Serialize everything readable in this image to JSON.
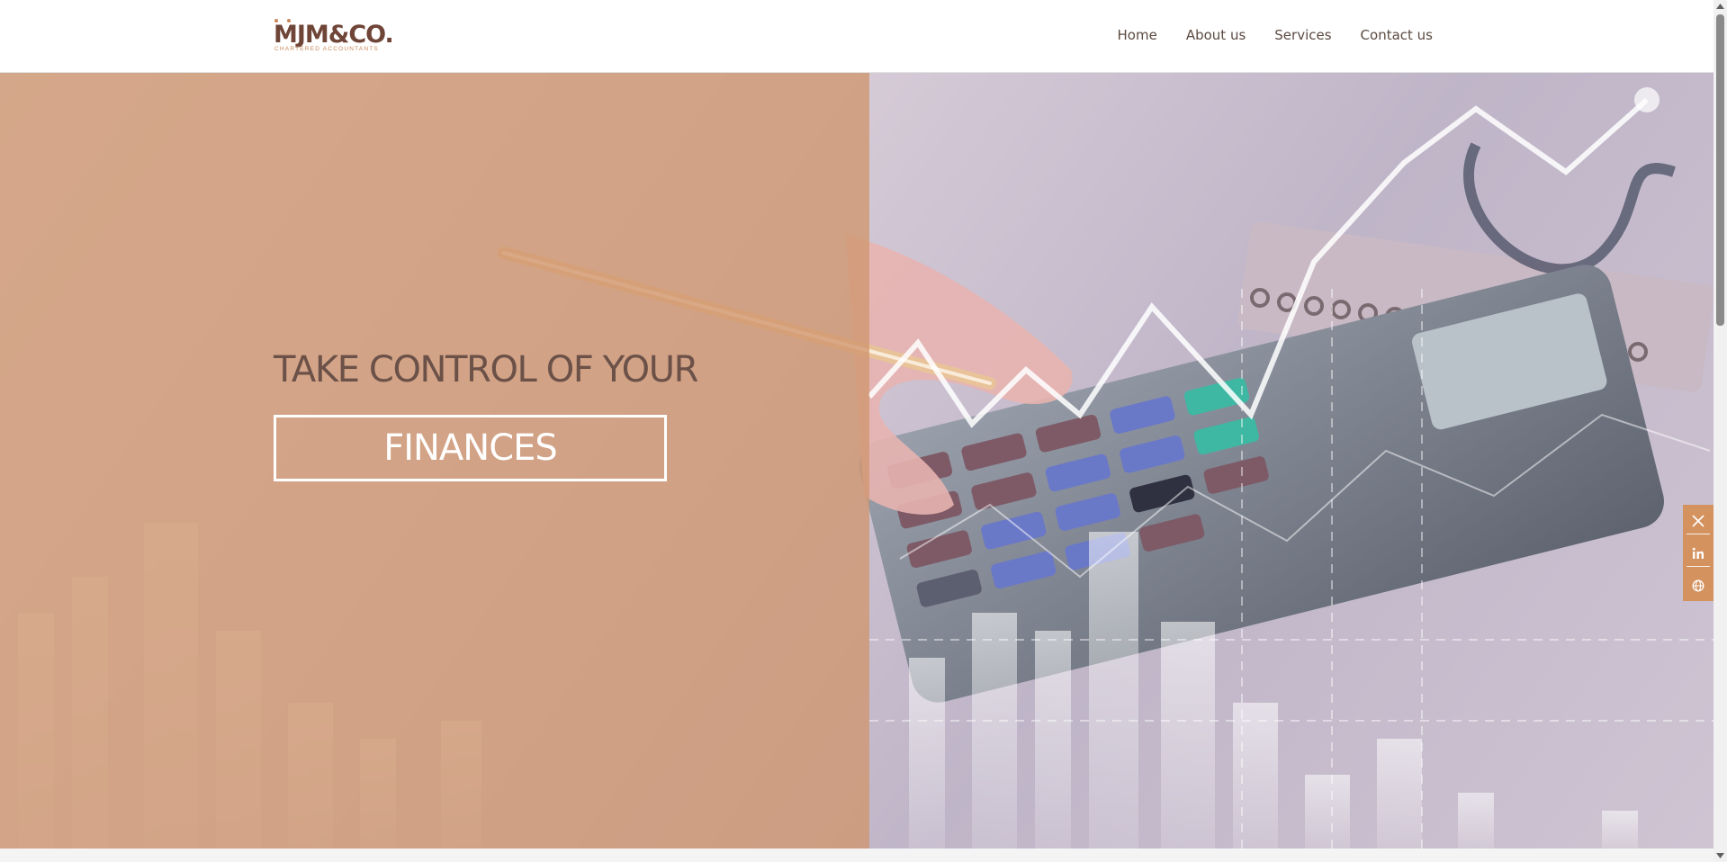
{
  "brand": {
    "name": "MJM&CO.",
    "tagline": "CHARTERED ACCOUNTANTS"
  },
  "nav": {
    "items": [
      {
        "label": "Home"
      },
      {
        "label": "About us"
      },
      {
        "label": "Services"
      },
      {
        "label": "Contact us"
      }
    ]
  },
  "hero": {
    "headline": "TAKE CONTROL OF YOUR",
    "highlight": "FINANCES"
  },
  "social": {
    "items": [
      {
        "icon": "x-twitter-icon"
      },
      {
        "icon": "linkedin-icon"
      },
      {
        "icon": "globe-icon"
      }
    ]
  },
  "colors": {
    "accent": "#d4925f",
    "brand_dark": "#6f4538",
    "nav_text": "#5a4a42",
    "hero_tint": "#d0966e"
  }
}
